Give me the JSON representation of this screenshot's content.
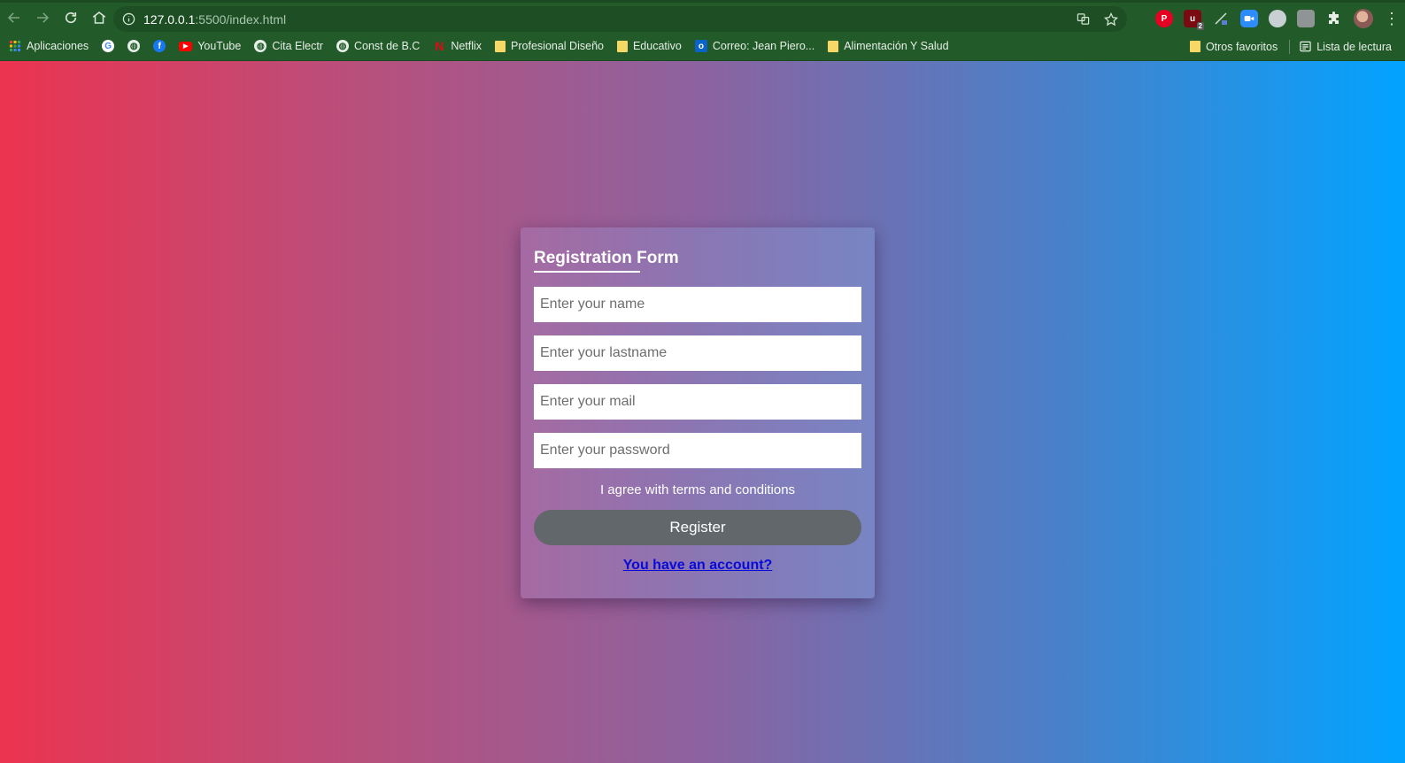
{
  "browser": {
    "url_host": "127.0.0.1",
    "url_path": ":5500/index.html",
    "icons": {
      "back": "back-arrow-icon",
      "forward": "forward-arrow-icon",
      "reload": "reload-icon",
      "home": "home-icon",
      "info": "info-icon",
      "translate": "translate-icon",
      "star": "star-icon"
    },
    "extension_badge": "2"
  },
  "bookmarks": {
    "items": [
      {
        "label": "Aplicaciones",
        "icon": "apps-grid-icon"
      },
      {
        "label": "",
        "icon": "google-icon"
      },
      {
        "label": "",
        "icon": "globe-icon"
      },
      {
        "label": "",
        "icon": "facebook-icon"
      },
      {
        "label": "YouTube",
        "icon": "youtube-icon"
      },
      {
        "label": "Cita Electr",
        "icon": "globe-icon"
      },
      {
        "label": "Const de B.C",
        "icon": "globe-icon"
      },
      {
        "label": "Netflix",
        "icon": "netflix-icon"
      },
      {
        "label": "Profesional Diseño",
        "icon": "folder-icon"
      },
      {
        "label": "Educativo",
        "icon": "folder-icon"
      },
      {
        "label": "Correo: Jean Piero...",
        "icon": "outlook-icon"
      },
      {
        "label": "Alimentación Y Salud",
        "icon": "folder-icon"
      }
    ],
    "other_favorites": "Otros favoritos",
    "reading_list": "Lista de lectura"
  },
  "form": {
    "title": "Registration Form",
    "name_placeholder": "Enter your name",
    "lastname_placeholder": "Enter your lastname",
    "mail_placeholder": "Enter your mail",
    "password_placeholder": "Enter your password",
    "terms_text": "I agree with terms and conditions",
    "register_label": "Register",
    "account_link": "You have an account?"
  },
  "colors": {
    "gradient_left": "#ec3350",
    "gradient_right": "#02a3ff",
    "button_bg": "#62676c",
    "link": "#0a0ad8",
    "toolbar": "#235a2a"
  }
}
